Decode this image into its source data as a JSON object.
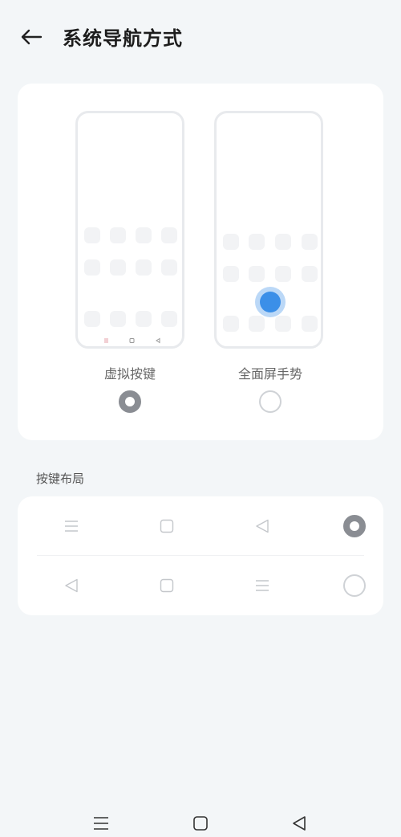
{
  "header": {
    "back_icon": "arrow-left-icon",
    "title": "系统导航方式"
  },
  "modes": [
    {
      "label": "虚拟按键",
      "selected": true
    },
    {
      "label": "全面屏手势",
      "selected": false
    }
  ],
  "section": {
    "label": "按键布局"
  },
  "layouts": [
    {
      "icons": [
        "menu-icon",
        "home-square-icon",
        "back-triangle-icon"
      ],
      "selected": true
    },
    {
      "icons": [
        "back-triangle-icon",
        "home-square-icon",
        "menu-icon"
      ],
      "selected": false
    }
  ],
  "system_nav": {
    "icons": [
      "menu-icon",
      "home-square-icon",
      "back-triangle-icon"
    ]
  },
  "colors": {
    "background": "#f3f6f8",
    "card": "#ffffff",
    "selected_radio": "#8a8d93",
    "gesture_dot": "#3b8fe8"
  }
}
